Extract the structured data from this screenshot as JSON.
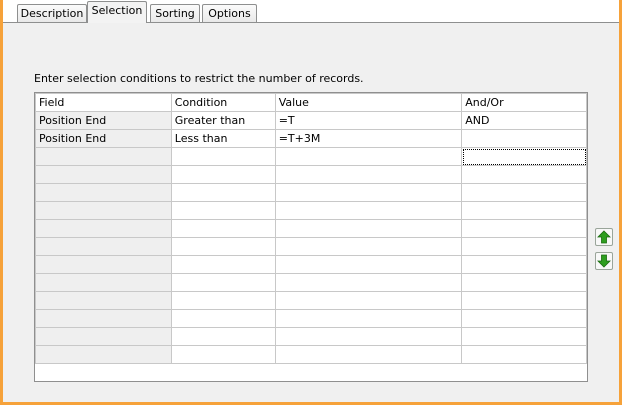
{
  "tabs": [
    {
      "label": "Description"
    },
    {
      "label": "Selection"
    },
    {
      "label": "Sorting"
    },
    {
      "label": "Options"
    }
  ],
  "active_tab": "Selection",
  "instruction": "Enter selection conditions to restrict the number of records.",
  "grid": {
    "columns": [
      "Field",
      "Condition",
      "Value",
      "And/Or"
    ],
    "rows": [
      [
        "Position End",
        "Greater than",
        "=T",
        "AND"
      ],
      [
        "Position End",
        "Less than",
        "=T+3M",
        ""
      ],
      [
        "",
        "",
        "",
        ""
      ],
      [
        "",
        "",
        "",
        ""
      ],
      [
        "",
        "",
        "",
        ""
      ],
      [
        "",
        "",
        "",
        ""
      ],
      [
        "",
        "",
        "",
        ""
      ],
      [
        "",
        "",
        "",
        ""
      ],
      [
        "",
        "",
        "",
        ""
      ],
      [
        "",
        "",
        "",
        ""
      ],
      [
        "",
        "",
        "",
        ""
      ],
      [
        "",
        "",
        "",
        ""
      ],
      [
        "",
        "",
        "",
        ""
      ],
      [
        "",
        "",
        "",
        ""
      ]
    ]
  },
  "buttons": {
    "move_up": {
      "icon": "arrow-up-icon"
    },
    "move_down": {
      "icon": "arrow-down-icon"
    }
  },
  "colors": {
    "accent_border": "#f6a23a",
    "arrow_green": "#2e9e1f"
  }
}
